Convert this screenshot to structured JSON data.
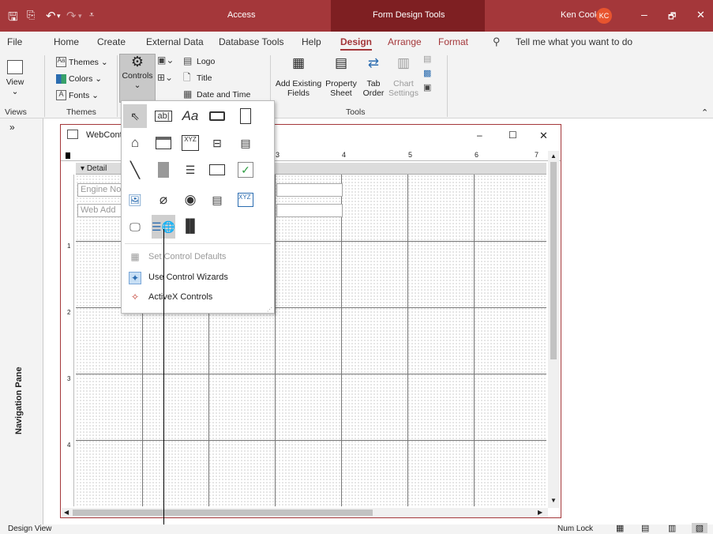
{
  "titlebar": {
    "app_name": "Access",
    "context_title": "Form Design Tools",
    "user_name": "Ken Cook",
    "user_initials": "KC",
    "minimize": "–",
    "restore": "🗗",
    "close": "✕"
  },
  "tabs": [
    "File",
    "Home",
    "Create",
    "External Data",
    "Database Tools",
    "Help",
    "Design",
    "Arrange",
    "Format"
  ],
  "active_tab": "Design",
  "tell_me": "Tell me what you want to do",
  "ribbon": {
    "view_label": "View",
    "themes_label": "Themes",
    "colors_label": "Colors",
    "fonts_label": "Fonts",
    "controls_label": "Controls",
    "logo_label": "Logo",
    "title_label": "Title",
    "date_time_label": "Date and Time",
    "add_existing_label1": "Add Existing",
    "add_existing_label2": "Fields",
    "property_label1": "Property",
    "property_label2": "Sheet",
    "tab_label1": "Tab",
    "tab_label2": "Order",
    "chart_label1": "Chart",
    "chart_label2": "Settings",
    "groups": {
      "views": "Views",
      "themes": "Themes",
      "tools": "Tools"
    }
  },
  "navpane": {
    "label": "Navigation Pane",
    "toggle": "»"
  },
  "form": {
    "title": "WebCont",
    "detail_label": "Detail",
    "fields": [
      "Engine No",
      "Web Add"
    ],
    "min": "–",
    "max": "☐",
    "close": "✕",
    "ruler_numbers": [
      "3",
      "4",
      "5",
      "6",
      "7"
    ],
    "vruler_numbers": [
      "1",
      "2",
      "3",
      "4"
    ]
  },
  "dropdown": {
    "menu_items": [
      {
        "label": "Set Control Defaults",
        "disabled": true
      },
      {
        "label": "Use Control Wizards",
        "disabled": false
      },
      {
        "label": "ActiveX Controls",
        "disabled": false
      }
    ],
    "label_sample": "Aa",
    "textbox_sample": "ab|",
    "xyz_sample": "XYZ"
  },
  "status": {
    "left": "Design View",
    "num_lock": "Num Lock"
  },
  "colors": {
    "accent": "#a4373a",
    "ribbon_bg": "#f3f3f3"
  }
}
